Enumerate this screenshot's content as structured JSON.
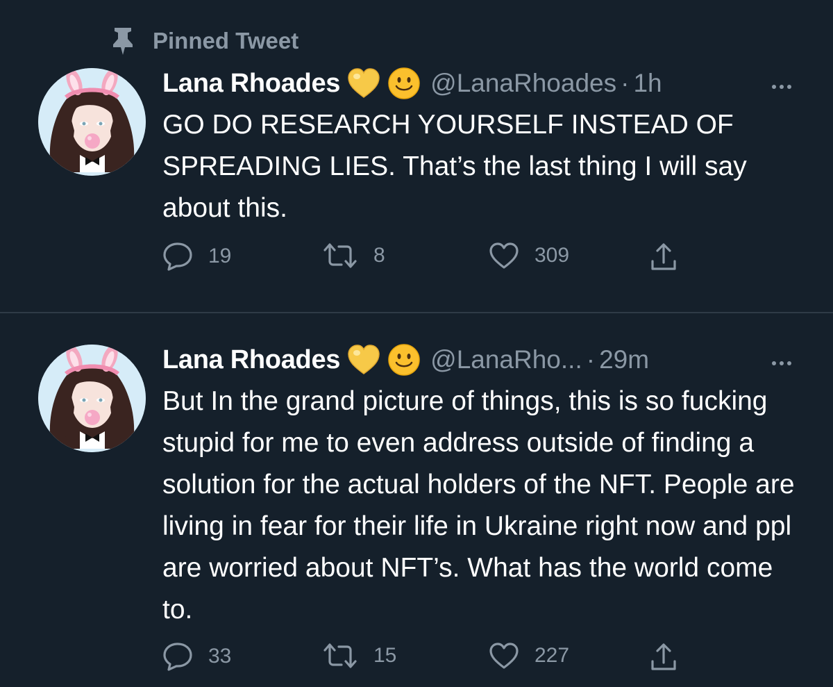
{
  "pinned": {
    "label": "Pinned Tweet",
    "icon": "pin-icon"
  },
  "colors": {
    "background": "#15202b",
    "secondary_text": "#8b98a5",
    "primary_text": "#ffffff",
    "divider": "#2f3b47",
    "heart_emoji": "#f7c948",
    "smiley_emoji": "#fbc02d"
  },
  "tweets": [
    {
      "name": "Lana Rhoades",
      "handle": "@LanaRhoades",
      "separator": "·",
      "time": "1h",
      "text": "GO DO RESEARCH YOURSELF INSTEAD OF SPREADING LIES. That’s the last thing I will say about this.",
      "replies": "19",
      "retweets": "8",
      "likes": "309"
    },
    {
      "name": "Lana Rhoades",
      "handle": "@LanaRho...",
      "separator": "·",
      "time": "29m",
      "text": "But In the grand picture of things, this is so fucking stupid for me to even address outside of finding a solution for the actual holders of the NFT. People are living in fear for their life in Ukraine right now and ppl are worried about NFT’s. What has the world come to.",
      "replies": "33",
      "retweets": "15",
      "likes": "227"
    }
  ],
  "icons": {
    "reply": "reply-icon",
    "retweet": "retweet-icon",
    "like": "like-icon",
    "share": "share-icon",
    "more": "more-icon",
    "heart_emoji": "yellow-heart-emoji",
    "smiley_emoji": "smiley-emoji"
  }
}
